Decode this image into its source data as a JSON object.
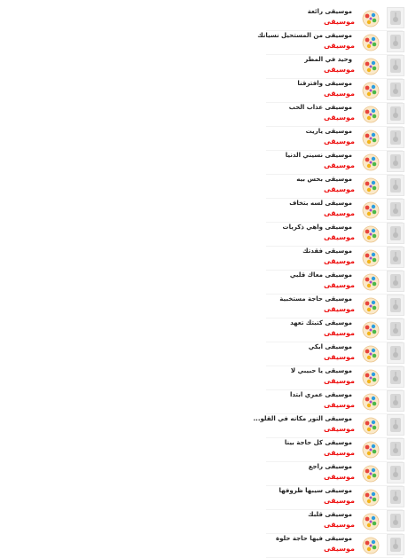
{
  "rows": [
    {
      "title": "موسيقى رائعة",
      "category": "موسيقى"
    },
    {
      "title": "موسيقى من المستحيل نسيانك",
      "category": "موسيقى"
    },
    {
      "title": "وحيد في المطر",
      "category": "موسيقى"
    },
    {
      "title": "موسيقى وافترقنا",
      "category": "موسيقى"
    },
    {
      "title": "موسيقى عذاب الحب",
      "category": "موسيقى"
    },
    {
      "title": "موسيقى ياريت",
      "category": "موسيقى"
    },
    {
      "title": "موسيقى نسيني الدنيا",
      "category": "موسيقى"
    },
    {
      "title": "موسيقى بحس بيه",
      "category": "موسيقى"
    },
    {
      "title": "موسيقى لسه بتخاف",
      "category": "موسيقى"
    },
    {
      "title": "موسيقى واهي ذكريات",
      "category": "موسيقى"
    },
    {
      "title": "موسيقى فقدتك",
      "category": "موسيقى"
    },
    {
      "title": "موسيقى معاك قلبي",
      "category": "موسيقى"
    },
    {
      "title": "موسيقى حاجة مستخبية",
      "category": "موسيقى"
    },
    {
      "title": "موسيقى كتبتك تعهد",
      "category": "موسيقى"
    },
    {
      "title": "موسيقى ابكي",
      "category": "موسيقى"
    },
    {
      "title": "موسيقى يا حبيبي لا",
      "category": "موسيقى"
    },
    {
      "title": "موسيقى عمري ابتدا",
      "category": "موسيقى"
    },
    {
      "title": "موسيقى النور مكانه في القلو...",
      "category": "موسيقى"
    },
    {
      "title": "موسيقى كل حاجة بينا",
      "category": "موسيقى"
    },
    {
      "title": "موسيقى راجع",
      "category": "موسيقى"
    },
    {
      "title": "موسيقى سيبها ظروفها",
      "category": "موسيقى"
    },
    {
      "title": "موسيقى قلبك",
      "category": "موسيقى"
    },
    {
      "title": "موسيقى فيها حاجة حلوة",
      "category": "موسيقى"
    }
  ],
  "icons": {
    "row_icon": "colorful-circle-icon",
    "thumb": "music-player-icon"
  },
  "colors": {
    "category": "#ee1111",
    "title": "#222222"
  }
}
